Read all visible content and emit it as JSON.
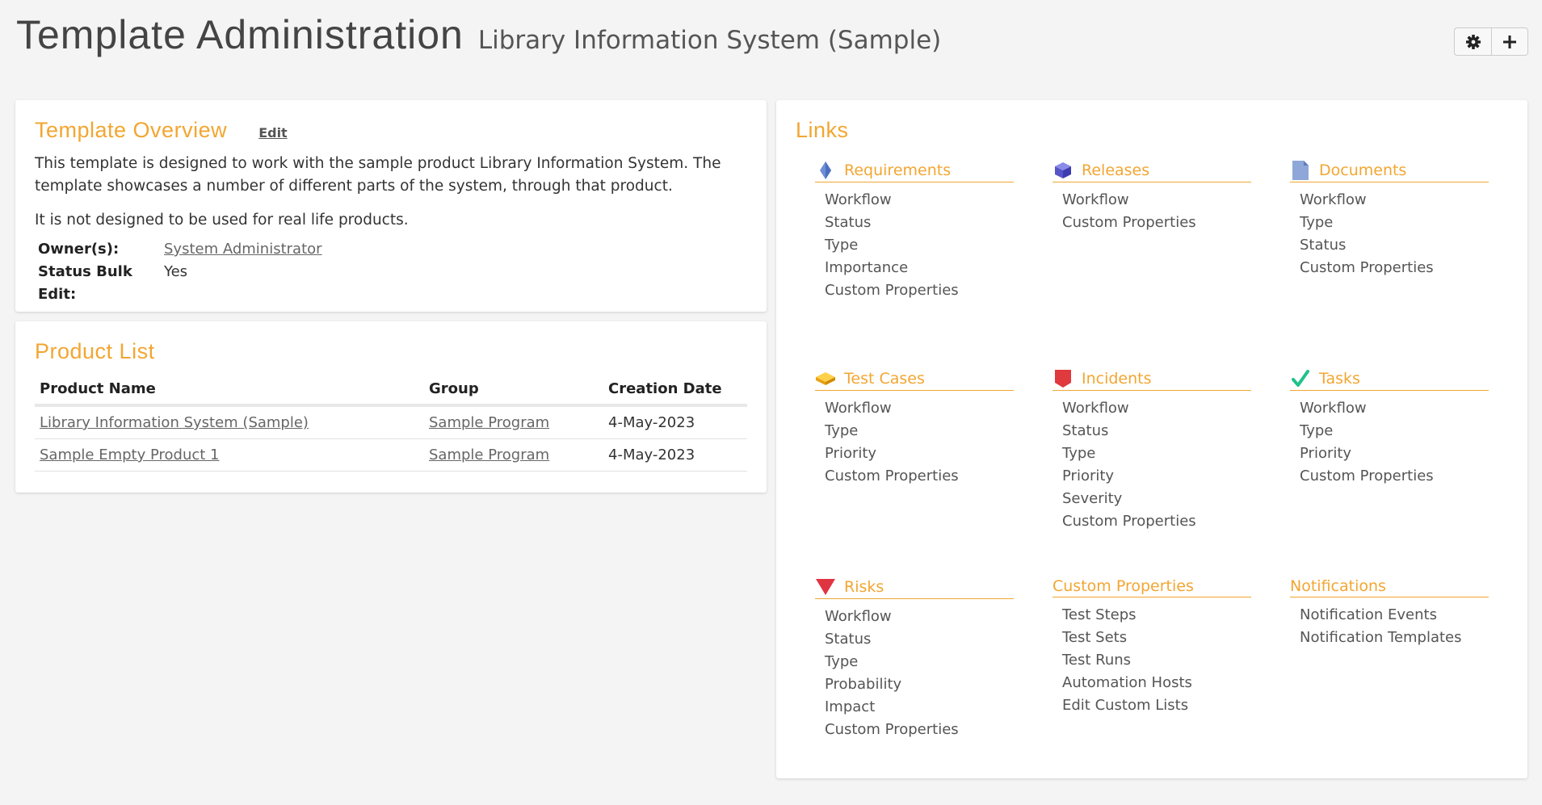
{
  "header": {
    "title": "Template Administration",
    "subtitle": "Library Information System (Sample)"
  },
  "toolbar": {
    "settings_icon": "gear-icon",
    "add_icon": "plus-icon"
  },
  "overview": {
    "title": "Template Overview",
    "edit_label": "Edit",
    "description": "This template is designed to work with the sample product Library Information System. The template showcases a number of different parts of the system, through that product.",
    "note": "It is not designed to be used for real life products.",
    "owner_label": "Owner(s):",
    "owner_value": "System Administrator",
    "bulk_label": "Status Bulk Edit:",
    "bulk_value": "Yes"
  },
  "products": {
    "title": "Product List",
    "columns": [
      "Product Name",
      "Group",
      "Creation Date"
    ],
    "rows": [
      {
        "name": "Library Information System (Sample)",
        "group": "Sample Program",
        "date": "4-May-2023"
      },
      {
        "name": "Sample Empty Product 1",
        "group": "Sample Program",
        "date": "4-May-2023"
      }
    ]
  },
  "links": {
    "title": "Links",
    "sections": [
      {
        "title": "Requirements",
        "icon": "requirement-diamond-icon",
        "items": [
          "Workflow",
          "Status",
          "Type",
          "Importance",
          "Custom Properties"
        ]
      },
      {
        "title": "Releases",
        "icon": "release-cube-icon",
        "items": [
          "Workflow",
          "Custom Properties"
        ]
      },
      {
        "title": "Documents",
        "icon": "document-icon",
        "items": [
          "Workflow",
          "Type",
          "Status",
          "Custom Properties"
        ]
      },
      {
        "title": "Test Cases",
        "icon": "test-case-icon",
        "items": [
          "Workflow",
          "Type",
          "Priority",
          "Custom Properties"
        ]
      },
      {
        "title": "Incidents",
        "icon": "incident-icon",
        "items": [
          "Workflow",
          "Status",
          "Type",
          "Priority",
          "Severity",
          "Custom Properties"
        ]
      },
      {
        "title": "Tasks",
        "icon": "task-check-icon",
        "items": [
          "Workflow",
          "Type",
          "Priority",
          "Custom Properties"
        ]
      },
      {
        "title": "Risks",
        "icon": "risk-triangle-icon",
        "items": [
          "Workflow",
          "Status",
          "Type",
          "Probability",
          "Impact",
          "Custom Properties"
        ]
      },
      {
        "title": "Custom Properties",
        "icon": "",
        "items": [
          "Test Steps",
          "Test Sets",
          "Test Runs",
          "Automation Hosts",
          "Edit Custom Lists"
        ]
      },
      {
        "title": "Notifications",
        "icon": "",
        "items": [
          "Notification Events",
          "Notification Templates"
        ]
      }
    ]
  }
}
